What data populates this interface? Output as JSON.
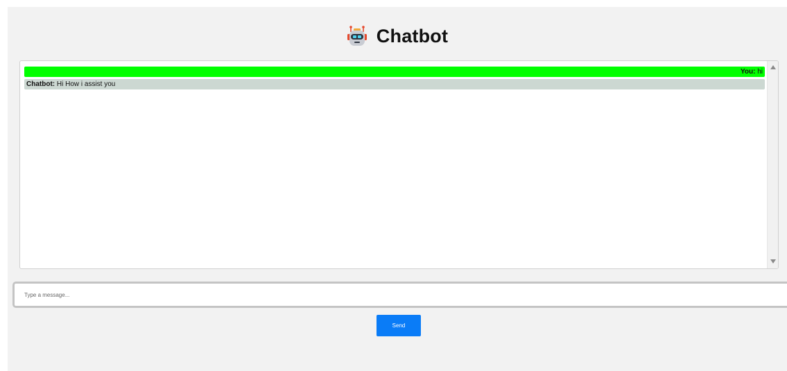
{
  "header": {
    "icon": "robot-icon",
    "title": "Chatbot"
  },
  "chat": {
    "messages": [
      {
        "sender": "You:",
        "text": " hi",
        "role": "user",
        "color": "#00ff00"
      },
      {
        "sender": "Chatbot:",
        "text": " Hi How i assist you",
        "role": "bot",
        "color": "#ccd8d2"
      }
    ]
  },
  "composer": {
    "placeholder": "Type a message...",
    "value": "",
    "send_label": "Send",
    "send_color": "#0a7cf7"
  }
}
